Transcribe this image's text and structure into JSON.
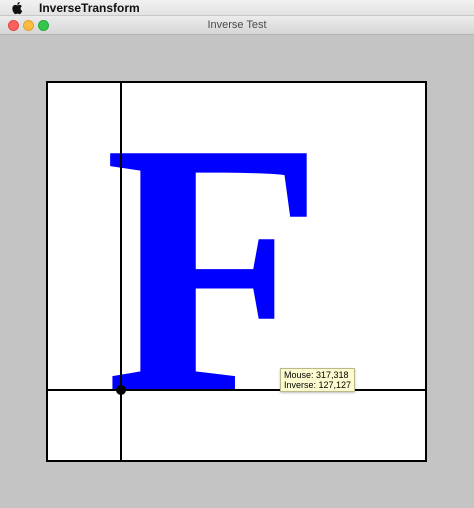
{
  "menubar": {
    "app_name": "InverseTransform"
  },
  "window": {
    "title": "Inverse Test"
  },
  "canvas": {
    "letter": "F",
    "letter_color": "#0000ff",
    "guide_color": "#000000"
  },
  "tooltip": {
    "mouse": "Mouse: 317,318",
    "inverse": "Inverse: 127,127"
  },
  "colors": {
    "close": "#fc605c",
    "minimize": "#fdbc40",
    "maximize": "#34c84a",
    "background": "#c4c4c4",
    "tooltip_bg": "#fbfbcf"
  }
}
